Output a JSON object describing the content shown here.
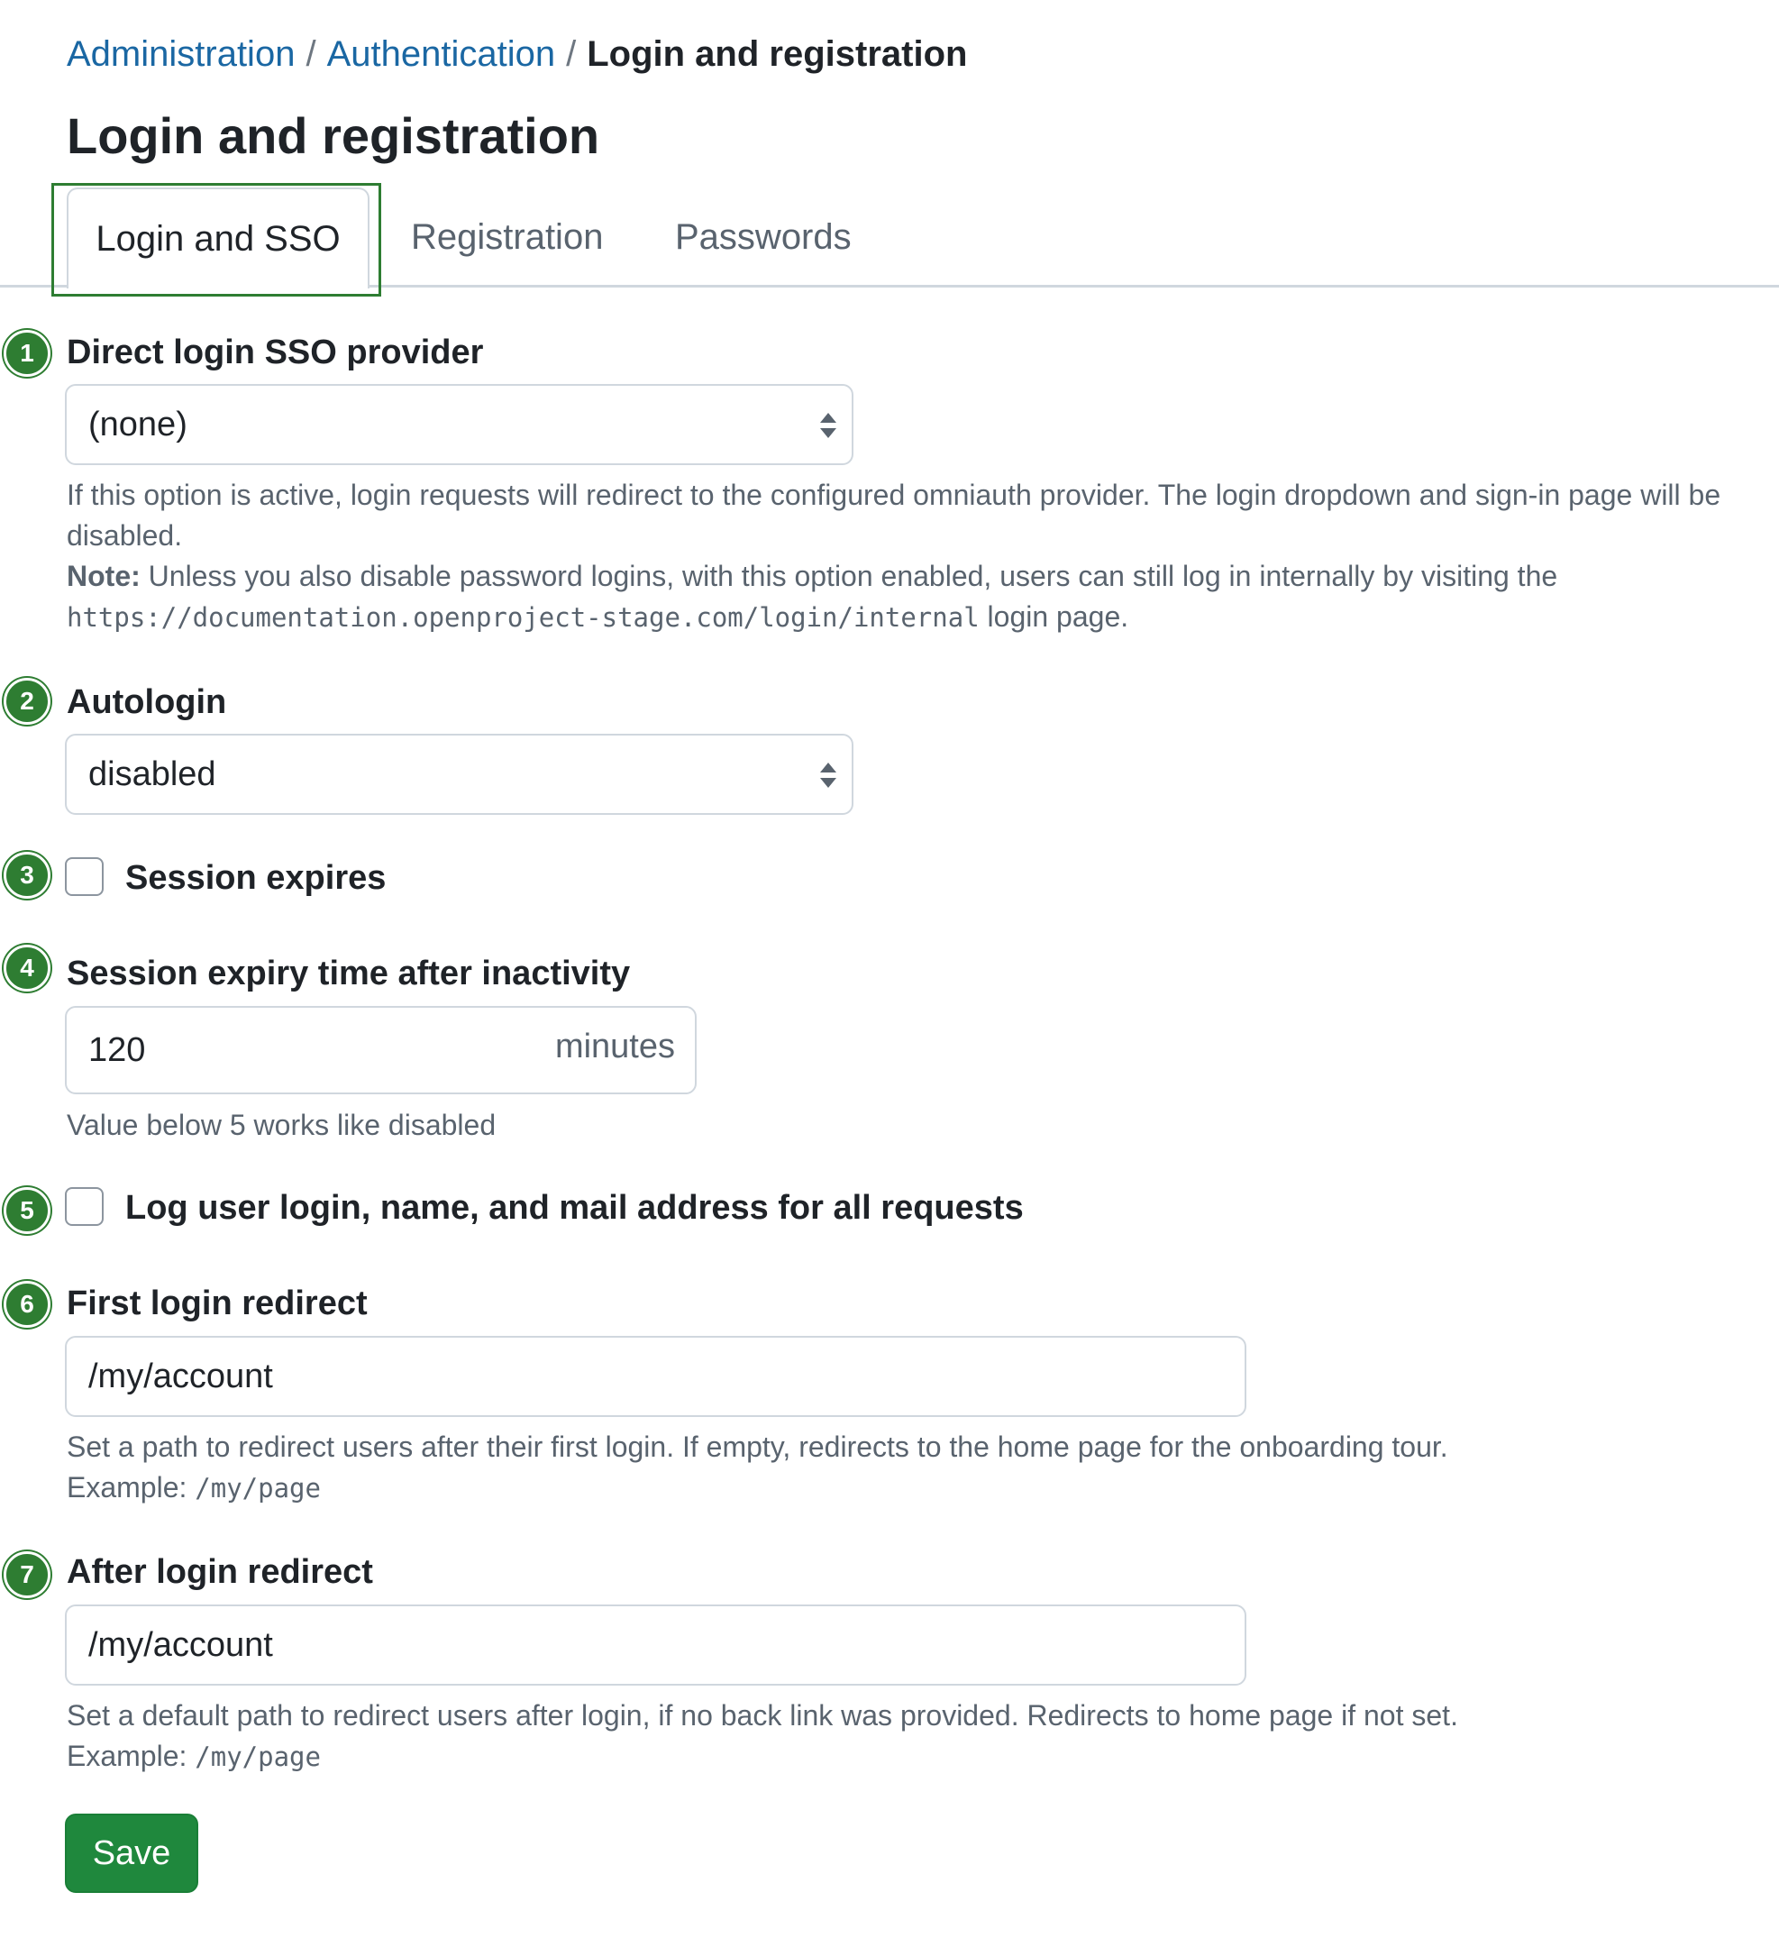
{
  "breadcrumb": {
    "items": [
      "Administration",
      "Authentication"
    ],
    "separator": "/",
    "current": "Login and registration"
  },
  "page": {
    "title": "Login and registration"
  },
  "tabs": [
    {
      "label": "Login and SSO",
      "active": true
    },
    {
      "label": "Registration",
      "active": false
    },
    {
      "label": "Passwords",
      "active": false
    }
  ],
  "fields": {
    "sso_provider": {
      "number": "1",
      "label": "Direct login SSO provider",
      "value": "(none)",
      "help_line1": "If this option is active, login requests will redirect to the configured omniauth provider. The login dropdown and sign-in page will be disabled.",
      "note_label": "Note:",
      "note_text": " Unless you also disable password logins, with this option enabled, users can still log in internally by visiting the ",
      "note_url": "https://documentation.openproject-stage.com/login/internal",
      "note_suffix": " login page."
    },
    "autologin": {
      "number": "2",
      "label": "Autologin",
      "value": "disabled"
    },
    "session_expires": {
      "number": "3",
      "label": "Session expires",
      "checked": false
    },
    "session_expiry_time": {
      "number": "4",
      "label": "Session expiry time after inactivity",
      "value": "120",
      "suffix": "minutes",
      "help": "Value below 5 works like disabled"
    },
    "log_user": {
      "number": "5",
      "label": "Log user login, name, and mail address for all requests",
      "checked": false
    },
    "first_login_redirect": {
      "number": "6",
      "label": "First login redirect",
      "value": "/my/account",
      "help": "Set a path to redirect users after their first login. If empty, redirects to the home page for the onboarding tour.",
      "example_label": "Example: ",
      "example_value": "/my/page"
    },
    "after_login_redirect": {
      "number": "7",
      "label": "After login redirect",
      "value": "/my/account",
      "help": "Set a default path to redirect users after login, if no back link was provided. Redirects to home page if not set.",
      "example_label": "Example: ",
      "example_value": "/my/page"
    }
  },
  "actions": {
    "save_label": "Save"
  },
  "colors": {
    "link": "#1a67a3",
    "callout": "#2e7d32",
    "save_button": "#1f883d",
    "help_text": "#59636e"
  },
  "icons": {
    "select_arrow": "up-down-caret-icon",
    "callout": "numbered-circle-badge"
  }
}
